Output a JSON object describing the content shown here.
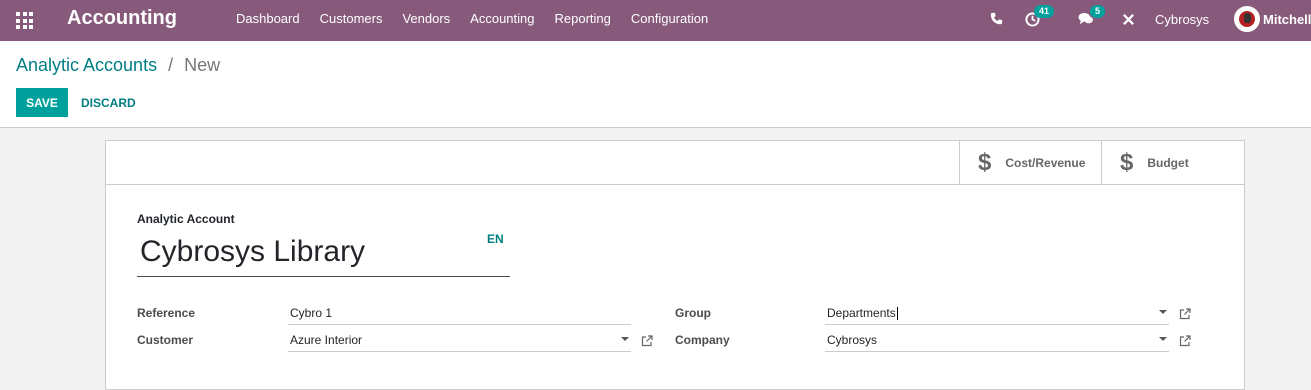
{
  "navbar": {
    "app_title": "Accounting",
    "menu": [
      "Dashboard",
      "Customers",
      "Vendors",
      "Accounting",
      "Reporting",
      "Configuration"
    ],
    "activity_count": "41",
    "message_count": "5",
    "company": "Cybrosys",
    "user": "Mitchell"
  },
  "breadcrumb": {
    "parent": "Analytic Accounts",
    "separator": "/",
    "current": "New"
  },
  "actions": {
    "save": "SAVE",
    "discard": "DISCARD"
  },
  "smart_buttons": {
    "cost_revenue": "Cost/Revenue",
    "budget": "Budget",
    "icon": "$"
  },
  "form": {
    "title_label": "Analytic Account",
    "name": "Cybrosys Library",
    "lang": "EN",
    "reference_label": "Reference",
    "reference_value": "Cybro 1",
    "customer_label": "Customer",
    "customer_value": "Azure Interior",
    "group_label": "Group",
    "group_value": "Departments",
    "company_label": "Company",
    "company_value": "Cybrosys"
  },
  "colors": {
    "navbar": "#875a7b",
    "primary": "#00a09d",
    "link": "#017e84"
  }
}
